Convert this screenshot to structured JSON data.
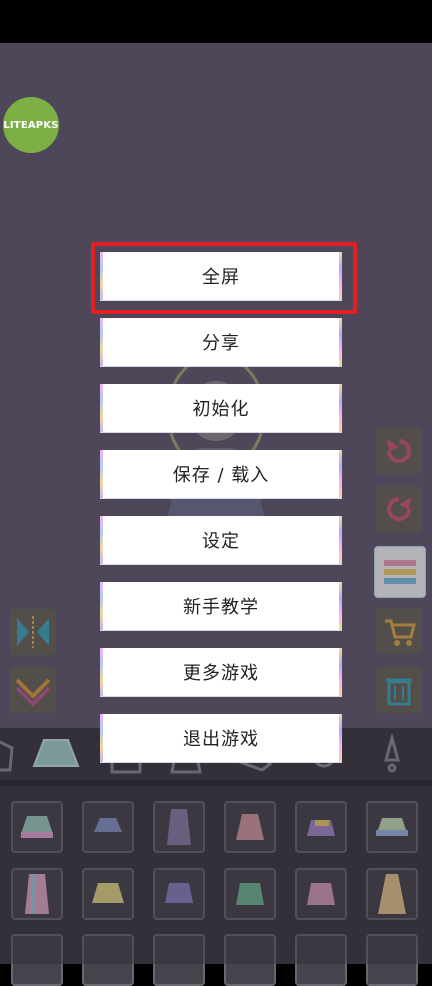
{
  "badge": {
    "label": "LITEAPKS"
  },
  "menu": {
    "items": [
      {
        "label": "全屏"
      },
      {
        "label": "分享"
      },
      {
        "label": "初始化"
      },
      {
        "label": "保存 / 载入"
      },
      {
        "label": "设定"
      },
      {
        "label": "新手教学"
      },
      {
        "label": "更多游戏"
      },
      {
        "label": "退出游戏"
      }
    ],
    "highlighted_item": "全屏"
  },
  "side_buttons": {
    "left": [
      "flip-icon",
      "layers-down-icon"
    ],
    "right": [
      "undo-icon",
      "redo-icon",
      "list-icon",
      "cart-icon",
      "trash-icon"
    ]
  },
  "categories": [
    "top-icon",
    "skirt-icon",
    "jacket-icon",
    "dress-icon",
    "shoe-icon",
    "accessory-icon",
    "hair-icon",
    "exclamation-icon"
  ],
  "colors": {
    "highlight": "#e01f26",
    "badge": "#7db044",
    "background": "#615a6f"
  }
}
